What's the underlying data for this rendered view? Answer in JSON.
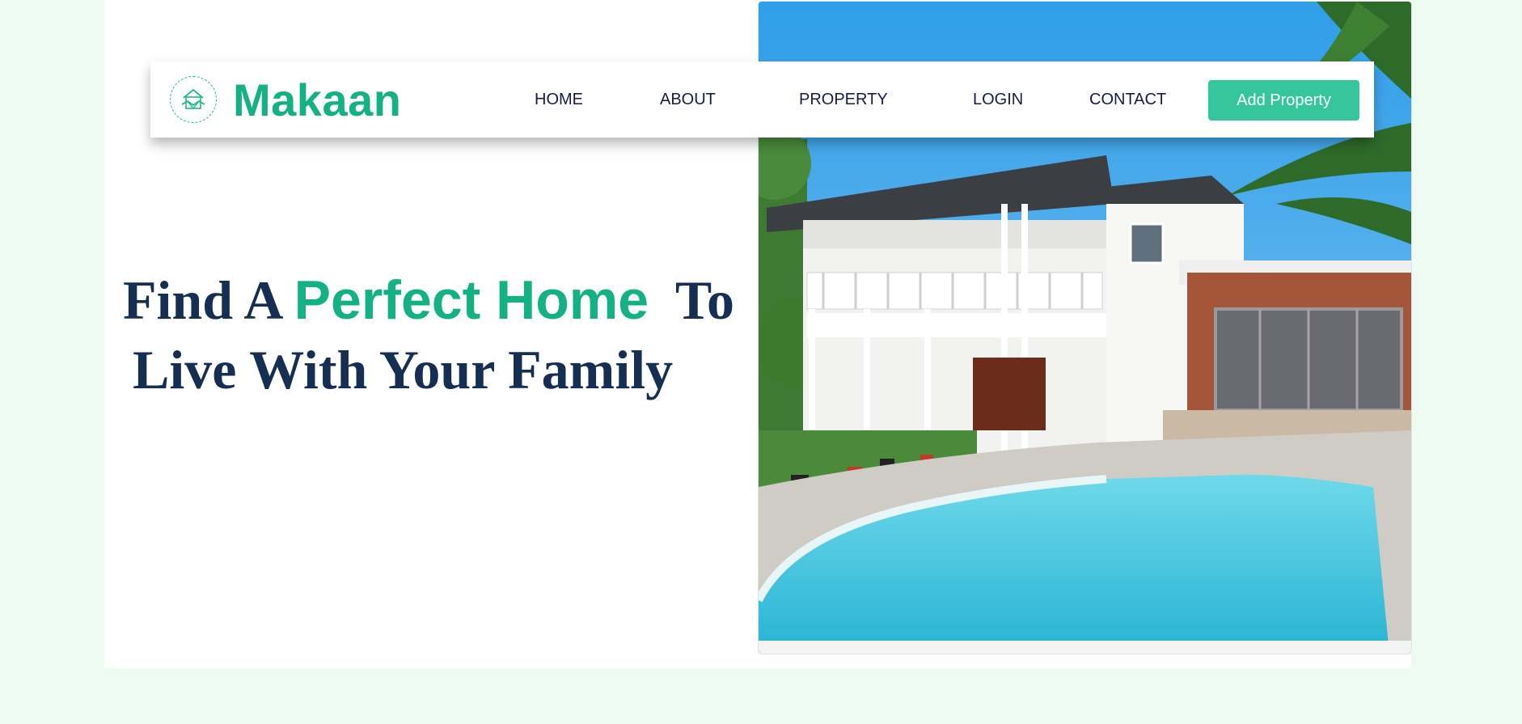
{
  "brand": {
    "name": "Makaan",
    "logo_icon": "handshake-house-icon"
  },
  "nav": {
    "items": [
      {
        "label": "HOME"
      },
      {
        "label": "ABOUT"
      },
      {
        "label": "PROPERTY"
      },
      {
        "label": "LOGIN"
      },
      {
        "label": "CONTACT"
      }
    ],
    "cta_label": "Add Property"
  },
  "hero": {
    "title_part1": "Find A ",
    "title_highlight": "Perfect Home",
    "title_part2": "  To",
    "title_line2": "Live With Your Family"
  },
  "colors": {
    "accent": "#13b184",
    "button": "#36c69d",
    "heading": "#152e52",
    "nav_text": "#1a1a4a",
    "page_bg": "#eefbf3"
  }
}
